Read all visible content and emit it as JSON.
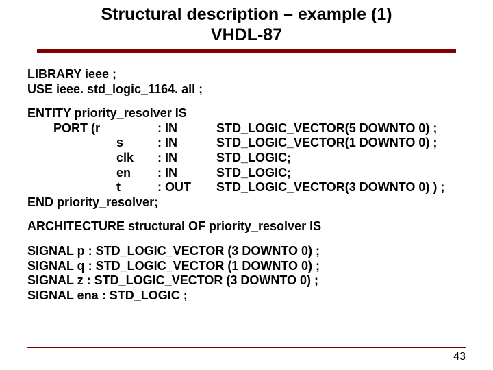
{
  "title_line1": "Structural description – example (1)",
  "title_line2": "VHDL-87",
  "lib": "LIBRARY ieee ;",
  "use": "USE ieee. std_logic_1164. all ;",
  "ent": "ENTITY priority_resolver IS",
  "port_open": "PORT (r",
  "rdir": ": IN",
  "rty": "STD_LOGIC_VECTOR(5 DOWNTO 0) ;",
  "s": "s",
  "sdir": ": IN",
  "sty": "STD_LOGIC_VECTOR(1 DOWNTO 0) ;",
  "clk": "clk",
  "clkdir": ": IN",
  "clkty": "STD_LOGIC;",
  "en": "en",
  "endir": ": IN",
  "enty": "STD_LOGIC;",
  "t": "t",
  "tdir": ": OUT",
  "tty": "STD_LOGIC_VECTOR(3 DOWNTO 0) ) ;",
  "end": "END priority_resolver;",
  "arch": "ARCHITECTURE structural OF priority_resolver IS",
  "sigp": "SIGNAL  p : STD_LOGIC_VECTOR (3 DOWNTO 0) ;",
  "sigq": "SIGNAL  q : STD_LOGIC_VECTOR (1  DOWNTO 0) ;",
  "sigz": "SIGNAL  z : STD_LOGIC_VECTOR (3 DOWNTO 0) ;",
  "sigena": "SIGNAL  ena : STD_LOGIC ;",
  "page": "43"
}
